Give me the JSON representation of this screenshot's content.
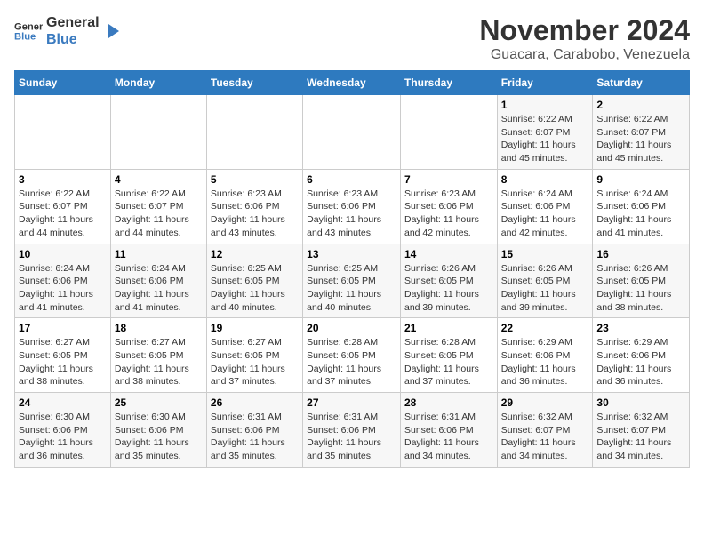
{
  "logo": {
    "line1": "General",
    "line2": "Blue"
  },
  "title": "November 2024",
  "subtitle": "Guacara, Carabobo, Venezuela",
  "days_of_week": [
    "Sunday",
    "Monday",
    "Tuesday",
    "Wednesday",
    "Thursday",
    "Friday",
    "Saturday"
  ],
  "weeks": [
    [
      {
        "day": "",
        "info": ""
      },
      {
        "day": "",
        "info": ""
      },
      {
        "day": "",
        "info": ""
      },
      {
        "day": "",
        "info": ""
      },
      {
        "day": "",
        "info": ""
      },
      {
        "day": "1",
        "info": "Sunrise: 6:22 AM\nSunset: 6:07 PM\nDaylight: 11 hours\nand 45 minutes."
      },
      {
        "day": "2",
        "info": "Sunrise: 6:22 AM\nSunset: 6:07 PM\nDaylight: 11 hours\nand 45 minutes."
      }
    ],
    [
      {
        "day": "3",
        "info": "Sunrise: 6:22 AM\nSunset: 6:07 PM\nDaylight: 11 hours\nand 44 minutes."
      },
      {
        "day": "4",
        "info": "Sunrise: 6:22 AM\nSunset: 6:07 PM\nDaylight: 11 hours\nand 44 minutes."
      },
      {
        "day": "5",
        "info": "Sunrise: 6:23 AM\nSunset: 6:06 PM\nDaylight: 11 hours\nand 43 minutes."
      },
      {
        "day": "6",
        "info": "Sunrise: 6:23 AM\nSunset: 6:06 PM\nDaylight: 11 hours\nand 43 minutes."
      },
      {
        "day": "7",
        "info": "Sunrise: 6:23 AM\nSunset: 6:06 PM\nDaylight: 11 hours\nand 42 minutes."
      },
      {
        "day": "8",
        "info": "Sunrise: 6:24 AM\nSunset: 6:06 PM\nDaylight: 11 hours\nand 42 minutes."
      },
      {
        "day": "9",
        "info": "Sunrise: 6:24 AM\nSunset: 6:06 PM\nDaylight: 11 hours\nand 41 minutes."
      }
    ],
    [
      {
        "day": "10",
        "info": "Sunrise: 6:24 AM\nSunset: 6:06 PM\nDaylight: 11 hours\nand 41 minutes."
      },
      {
        "day": "11",
        "info": "Sunrise: 6:24 AM\nSunset: 6:06 PM\nDaylight: 11 hours\nand 41 minutes."
      },
      {
        "day": "12",
        "info": "Sunrise: 6:25 AM\nSunset: 6:05 PM\nDaylight: 11 hours\nand 40 minutes."
      },
      {
        "day": "13",
        "info": "Sunrise: 6:25 AM\nSunset: 6:05 PM\nDaylight: 11 hours\nand 40 minutes."
      },
      {
        "day": "14",
        "info": "Sunrise: 6:26 AM\nSunset: 6:05 PM\nDaylight: 11 hours\nand 39 minutes."
      },
      {
        "day": "15",
        "info": "Sunrise: 6:26 AM\nSunset: 6:05 PM\nDaylight: 11 hours\nand 39 minutes."
      },
      {
        "day": "16",
        "info": "Sunrise: 6:26 AM\nSunset: 6:05 PM\nDaylight: 11 hours\nand 38 minutes."
      }
    ],
    [
      {
        "day": "17",
        "info": "Sunrise: 6:27 AM\nSunset: 6:05 PM\nDaylight: 11 hours\nand 38 minutes."
      },
      {
        "day": "18",
        "info": "Sunrise: 6:27 AM\nSunset: 6:05 PM\nDaylight: 11 hours\nand 38 minutes."
      },
      {
        "day": "19",
        "info": "Sunrise: 6:27 AM\nSunset: 6:05 PM\nDaylight: 11 hours\nand 37 minutes."
      },
      {
        "day": "20",
        "info": "Sunrise: 6:28 AM\nSunset: 6:05 PM\nDaylight: 11 hours\nand 37 minutes."
      },
      {
        "day": "21",
        "info": "Sunrise: 6:28 AM\nSunset: 6:05 PM\nDaylight: 11 hours\nand 37 minutes."
      },
      {
        "day": "22",
        "info": "Sunrise: 6:29 AM\nSunset: 6:06 PM\nDaylight: 11 hours\nand 36 minutes."
      },
      {
        "day": "23",
        "info": "Sunrise: 6:29 AM\nSunset: 6:06 PM\nDaylight: 11 hours\nand 36 minutes."
      }
    ],
    [
      {
        "day": "24",
        "info": "Sunrise: 6:30 AM\nSunset: 6:06 PM\nDaylight: 11 hours\nand 36 minutes."
      },
      {
        "day": "25",
        "info": "Sunrise: 6:30 AM\nSunset: 6:06 PM\nDaylight: 11 hours\nand 35 minutes."
      },
      {
        "day": "26",
        "info": "Sunrise: 6:31 AM\nSunset: 6:06 PM\nDaylight: 11 hours\nand 35 minutes."
      },
      {
        "day": "27",
        "info": "Sunrise: 6:31 AM\nSunset: 6:06 PM\nDaylight: 11 hours\nand 35 minutes."
      },
      {
        "day": "28",
        "info": "Sunrise: 6:31 AM\nSunset: 6:06 PM\nDaylight: 11 hours\nand 34 minutes."
      },
      {
        "day": "29",
        "info": "Sunrise: 6:32 AM\nSunset: 6:07 PM\nDaylight: 11 hours\nand 34 minutes."
      },
      {
        "day": "30",
        "info": "Sunrise: 6:32 AM\nSunset: 6:07 PM\nDaylight: 11 hours\nand 34 minutes."
      }
    ]
  ]
}
